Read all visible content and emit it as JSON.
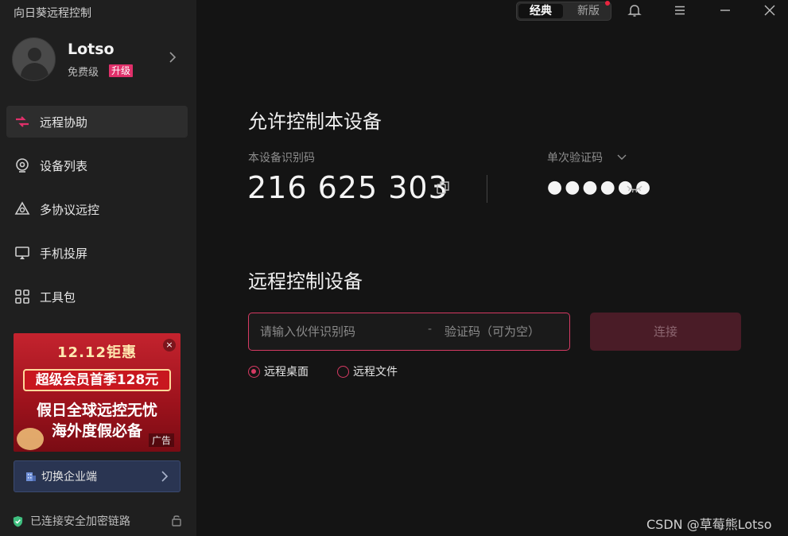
{
  "app": {
    "title": "向日葵远程控制"
  },
  "profile": {
    "name": "Lotso",
    "tier": "免费级",
    "upgrade_label": "升级"
  },
  "nav": {
    "items": [
      {
        "label": "远程协助",
        "icon": "remote-assist-icon",
        "active": true
      },
      {
        "label": "设备列表",
        "icon": "device-list-icon"
      },
      {
        "label": "多协议远控",
        "icon": "multi-protocol-icon"
      },
      {
        "label": "手机投屏",
        "icon": "screen-cast-icon"
      },
      {
        "label": "工具包",
        "icon": "toolkit-icon"
      }
    ]
  },
  "ad": {
    "line1": "12.12钜惠",
    "line2": "超级会员首季128元",
    "line3": "假日全球远控无忧",
    "line4": "海外度假必备",
    "tag": "广告",
    "close": "×"
  },
  "enterprise": {
    "label": "切换企业端"
  },
  "status": {
    "text": "已连接安全加密链路"
  },
  "topbar": {
    "classic_label": "经典",
    "new_label": "新版"
  },
  "allow": {
    "heading": "允许控制本设备",
    "id_label": "本设备识别码",
    "device_id": "216 625 303",
    "code_label": "单次验证码",
    "code_value": "●●●●●●"
  },
  "remote": {
    "heading": "远程控制设备",
    "partner_placeholder": "请输入伙伴识别码",
    "separator": "-",
    "code_placeholder": "验证码（可为空）",
    "connect_label": "连接",
    "option_desktop": "远程桌面",
    "option_file": "远程文件"
  },
  "watermark": "CSDN @草莓熊Lotso",
  "colors": {
    "accent": "#d63a63",
    "upgrade": "#e0306a",
    "background": "#141414",
    "sidebar": "#1f1f1f"
  }
}
